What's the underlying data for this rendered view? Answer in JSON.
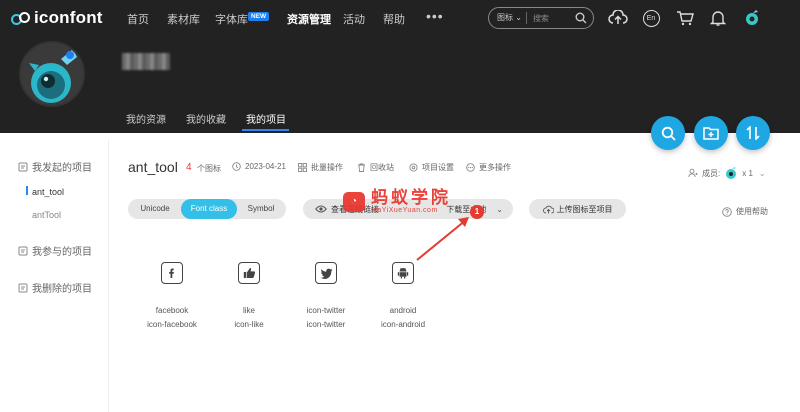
{
  "app": {
    "name": "iconfont"
  },
  "nav": {
    "items": [
      "首页",
      "素材库",
      "字体库",
      "资源管理",
      "活动",
      "帮助"
    ],
    "new_badge": "NEW",
    "more": "•••",
    "search_type": "图标",
    "search_placeholder": "搜索",
    "lang": "En"
  },
  "profile": {
    "tabs": [
      "我的资源",
      "我的收藏",
      "我的项目"
    ]
  },
  "sidebar": {
    "groups": [
      "我发起的项目",
      "我参与的项目",
      "我删除的项目"
    ],
    "items": [
      "ant_tool",
      "antTool"
    ]
  },
  "project": {
    "title": "ant_tool",
    "count": "4",
    "count_unit": "个图标",
    "date": "2023-04-21",
    "actions": [
      "批量操作",
      "回收站",
      "项目设置",
      "更多操作"
    ],
    "members_label": "成员:",
    "members_count": "x 1"
  },
  "toolbar": {
    "segments": [
      "Unicode",
      "Font class",
      "Symbol"
    ],
    "view_online": "查看在线链接",
    "download_local": "下载至本地",
    "upload": "上传图标至项目",
    "help": "使用帮助"
  },
  "icons": [
    {
      "name": "facebook",
      "class": "icon-facebook",
      "glyph": "facebook-icon"
    },
    {
      "name": "like",
      "class": "icon-like",
      "glyph": "thumbs-up-icon"
    },
    {
      "name": "icon-twitter",
      "class": "icon-twitter",
      "glyph": "twitter-icon"
    },
    {
      "name": "android",
      "class": "icon-android",
      "glyph": "android-icon"
    }
  ],
  "overlay": {
    "watermark_title": "蚂蚁学院",
    "watermark_sub": "MaYiXueYuan.com",
    "marker": "1"
  },
  "colors": {
    "accent": "#34bfe8",
    "header": "#222222",
    "count": "#e33333",
    "marker": "#e53a30"
  }
}
